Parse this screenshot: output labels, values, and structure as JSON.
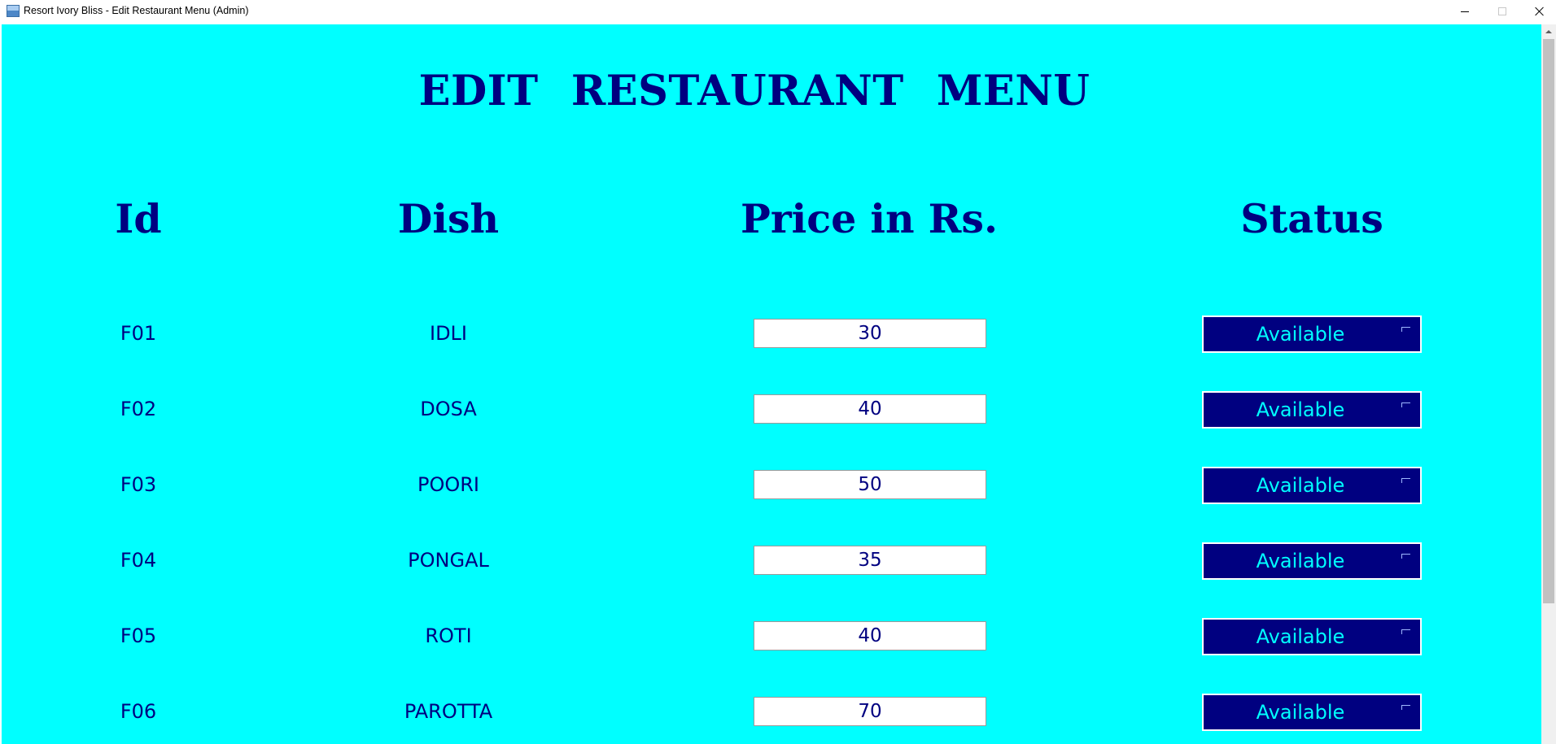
{
  "window": {
    "title": "Resort Ivory Bliss - Edit Restaurant Menu (Admin)",
    "controls": [
      "minimize",
      "maximize",
      "close"
    ]
  },
  "colors": {
    "background": "#00ffff",
    "heading": "#000080",
    "status_bg": "#000080",
    "status_text": "#00ffff"
  },
  "page": {
    "title": "EDIT RESTAURANT MENU"
  },
  "columns": {
    "id": "Id",
    "dish": "Dish",
    "price": "Price in Rs.",
    "status": "Status"
  },
  "rows": [
    {
      "id": "F01",
      "dish": "IDLI",
      "price": "30",
      "status": "Available"
    },
    {
      "id": "F02",
      "dish": "DOSA",
      "price": "40",
      "status": "Available"
    },
    {
      "id": "F03",
      "dish": "POORI",
      "price": "50",
      "status": "Available"
    },
    {
      "id": "F04",
      "dish": "PONGAL",
      "price": "35",
      "status": "Available"
    },
    {
      "id": "F05",
      "dish": "ROTI",
      "price": "40",
      "status": "Available"
    },
    {
      "id": "F06",
      "dish": "PAROTTA",
      "price": "70",
      "status": "Available"
    }
  ]
}
